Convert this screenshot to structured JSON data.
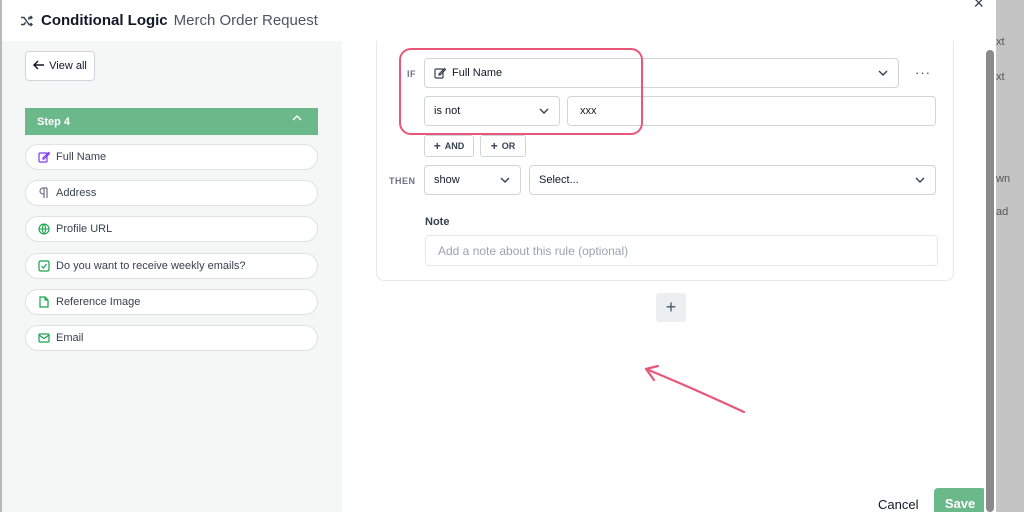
{
  "header": {
    "title": "Conditional Logic",
    "subtitle": "Merch Order Request",
    "close": "×"
  },
  "sidebar": {
    "view_all": "View all",
    "step": {
      "label": "Step 4",
      "chevron": "⌃"
    },
    "fields": [
      {
        "label": "Full Name",
        "icon": "edit-icon"
      },
      {
        "label": "Address",
        "icon": "paragraph-icon"
      },
      {
        "label": "Profile URL",
        "icon": "globe-icon"
      },
      {
        "label": "Do you want to receive weekly emails?",
        "icon": "checkbox-icon"
      },
      {
        "label": "Reference Image",
        "icon": "file-icon"
      },
      {
        "label": "Email",
        "icon": "mail-icon"
      }
    ]
  },
  "rule": {
    "if_label": "IF",
    "field_value": "Full Name",
    "operator_value": "is not",
    "compare_value": "xxx",
    "and_label": "AND",
    "or_label": "OR",
    "more": "···",
    "then_label": "THEN",
    "action_value": "show",
    "target_placeholder": "Select...",
    "note_label": "Note",
    "note_placeholder": "Add a note about this rule (optional)"
  },
  "add_rule": "+",
  "footer": {
    "cancel": "Cancel",
    "save": "Save"
  },
  "background_fragments": [
    "xt",
    "xt",
    "wn",
    "ad"
  ],
  "colors": {
    "accent": "#6bb98a",
    "highlight": "#e8577a"
  }
}
